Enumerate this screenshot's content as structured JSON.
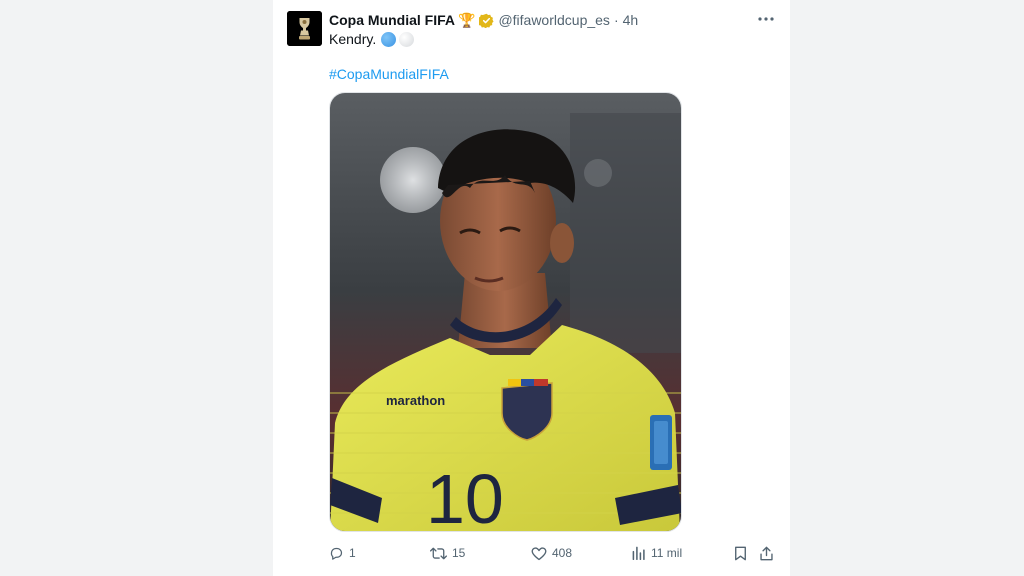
{
  "tweet": {
    "author": {
      "display_name": "Copa Mundial FIFA",
      "badge_emoji": "🏆",
      "verified_icon": "gold-verified-badge",
      "handle": "@fifaworldcup_es",
      "separator": "·",
      "time": "4h"
    },
    "text": "Kendry.",
    "emoji_icons": [
      "blue-ball-icon",
      "white-ball-icon"
    ],
    "hashtag": "#CopaMundialFIFA",
    "media": {
      "jersey_brand": "marathon",
      "jersey_number": "10"
    },
    "actions": {
      "reply_count": "1",
      "retweet_count": "15",
      "like_count": "408",
      "views_count": "11 mil"
    }
  },
  "colors": {
    "accent": "#1d9bf0",
    "secondary_text": "#536471",
    "verified_gold": "#e2b719",
    "jersey_yellow": "#e8e64a"
  }
}
